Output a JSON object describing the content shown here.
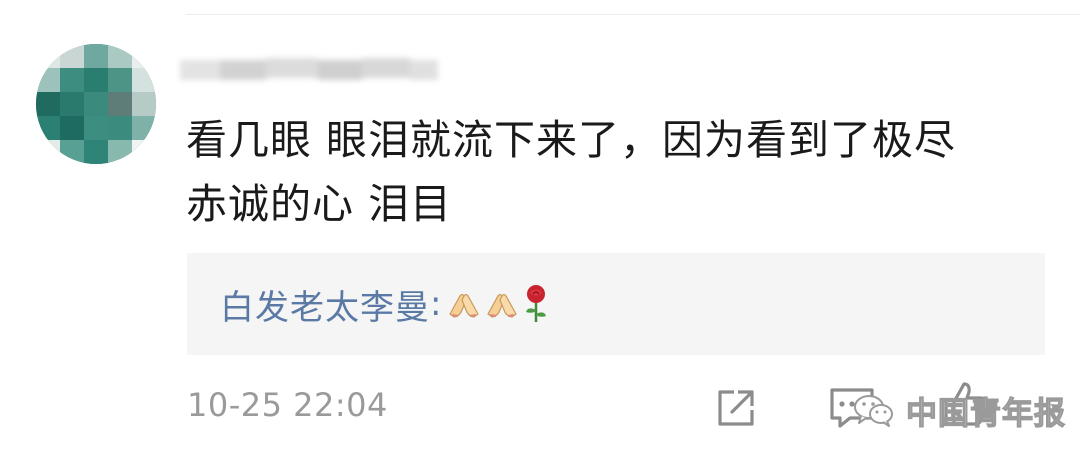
{
  "comment": {
    "text_line1": "看几眼 眼泪就流下来了，因为看到了极尽",
    "text_line2": "赤诚的心 泪目",
    "timestamp": "10-25 22:04"
  },
  "reply": {
    "author": "白发老太李曼",
    "separator": ":",
    "emojis": [
      "folded-hands-emoji",
      "folded-hands-emoji",
      "rose-emoji"
    ]
  },
  "actions": {
    "share": "share-icon",
    "comment": "comment-icon",
    "like": "thumbs-up-icon"
  },
  "watermark": {
    "text": "中国青年报",
    "icon": "wechat-icon"
  },
  "colors": {
    "reply_author": "#5a7aa5",
    "reply_bg": "#f5f5f5",
    "timestamp": "#9a9a9a",
    "body_text": "#1a1a1a",
    "avatar_green": "#2f8478"
  }
}
